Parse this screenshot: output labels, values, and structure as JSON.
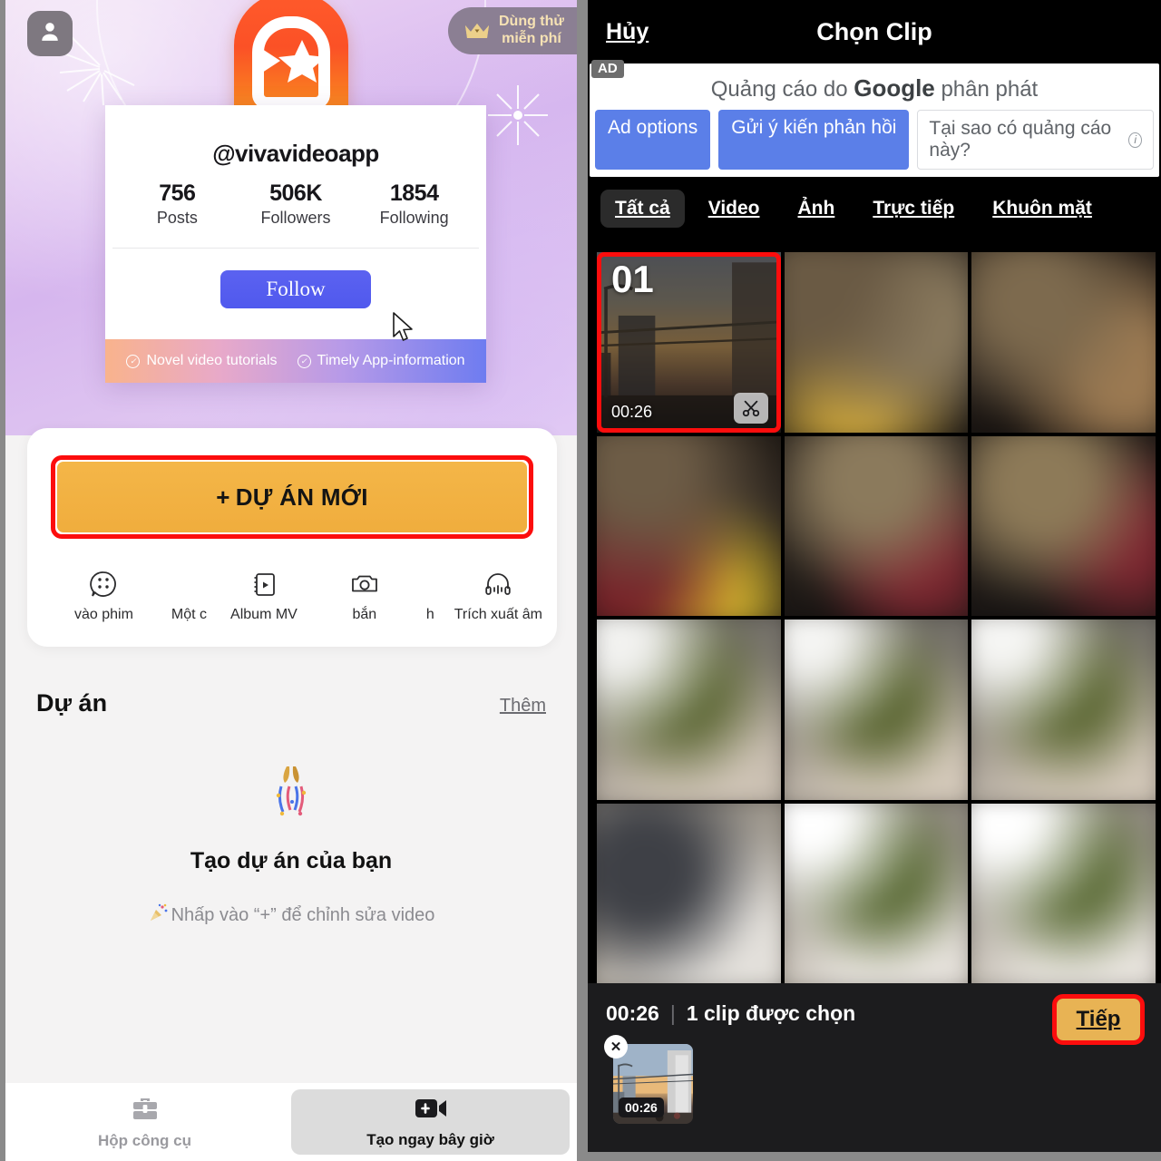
{
  "left": {
    "avatar_icon": "person-icon",
    "trial_badge": {
      "icon": "crown-icon",
      "label": "Dùng thử\nmiễn phí"
    },
    "app_logo_icon": "vivavideo-logo-icon",
    "profile_card": {
      "handle": "@vivavideoapp",
      "stats": [
        {
          "value": "756",
          "label": "Posts"
        },
        {
          "value": "506K",
          "label": "Followers"
        },
        {
          "value": "1854",
          "label": "Following"
        }
      ],
      "follow_label": "Follow",
      "cursor_icon": "mouse-pointer-icon",
      "footer_items": [
        "Novel video tutorials",
        "Timely App-information"
      ]
    },
    "new_project_button": {
      "plus": "+",
      "label": "DỰ ÁN MỚI",
      "highlight_color": "#fc0d0d",
      "fill_color": "#f0ad3d"
    },
    "tools": [
      {
        "icon": "film-reel-icon",
        "label": "vào phim"
      },
      {
        "icon": "single-icon",
        "label": "Một c"
      },
      {
        "icon": "mv-album-icon",
        "label": "Album MV"
      },
      {
        "icon": "camera-icon",
        "label": "bắn"
      },
      {
        "icon": "h-icon",
        "label": "h"
      },
      {
        "icon": "headphones-icon",
        "label": "Trích xuất âm"
      }
    ],
    "projects": {
      "title": "Dự án",
      "more_label": "Thêm",
      "empty_icon": "confetti-popper-icon",
      "empty_title": "Tạo dự án của bạn",
      "empty_sub_icon": "party-popper-icon",
      "empty_sub": "Nhấp vào “+” để chỉnh sửa video"
    },
    "bottom_bar": [
      {
        "icon": "toolbox-icon",
        "label": "Hộp công cụ",
        "active": false
      },
      {
        "icon": "video-plus-icon",
        "label": "Tạo ngay bây giờ",
        "active": true
      }
    ]
  },
  "right": {
    "header": {
      "cancel_label": "Hủy",
      "title": "Chọn Clip"
    },
    "ad": {
      "tag": "AD",
      "line_prefix": "Quảng cáo do ",
      "brand": "Google",
      "line_suffix": " phân phát",
      "options_label": "Ad options",
      "feedback_label": "Gửi ý kiến phản hồi",
      "why_label": "Tại sao có quảng cáo này?",
      "info_icon": "info-circle-icon"
    },
    "tabs": [
      {
        "label": "Tất cả",
        "active": true
      },
      {
        "label": "Video",
        "active": false
      },
      {
        "label": "Ảnh",
        "active": false
      },
      {
        "label": "Trực tiếp",
        "active": false
      },
      {
        "label": "Khuôn mặt",
        "active": false
      }
    ],
    "selected_clip": {
      "order_number": "01",
      "duration": "00:26",
      "trim_icon": "scissors-icon",
      "highlight_color": "#fc0d0d"
    },
    "bottom": {
      "total_duration": "00:26",
      "separator": "|",
      "selection_text": "1 clip được chọn",
      "next_label": "Tiếp",
      "next_highlight_color": "#fc0d0d",
      "next_fill_color": "#e8b354",
      "strip_clip": {
        "duration": "00:26",
        "remove_icon": "close-x-icon"
      }
    }
  }
}
